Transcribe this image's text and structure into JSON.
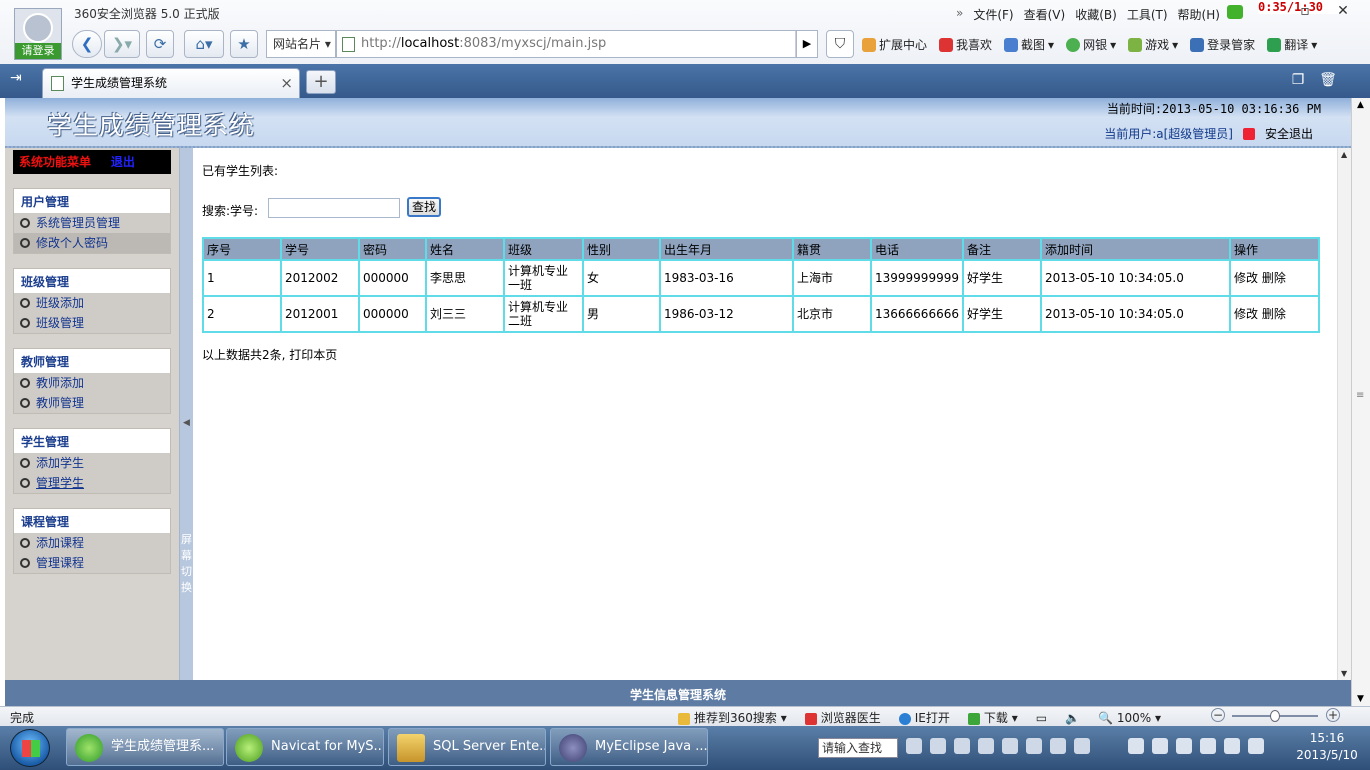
{
  "browser": {
    "title": "360安全浏览器 5.0 正式版",
    "login_label": "请登录",
    "menu": [
      "文件(F)",
      "查看(V)",
      "收藏(B)",
      "工具(T)",
      "帮助(H)"
    ],
    "clock_overlay": "0:35/1:30",
    "site_names_label": "网站名片",
    "address": {
      "scheme": "http://",
      "domain": "localhost",
      "rest": ":8083/myxscj/main.jsp"
    },
    "extensions": [
      "扩展中心",
      "我喜欢",
      "截图",
      "网银",
      "游戏",
      "登录管家",
      "翻译"
    ],
    "tab_title": "学生成绩管理系统",
    "icon_names": [
      "back-arrow-icon",
      "forward-arrow-icon",
      "refresh-icon",
      "home-icon",
      "star-icon",
      "shield-icon"
    ]
  },
  "page": {
    "system_title": "学生成绩管理系统",
    "current_time": "当前时间:2013-05-10 03:16:36 PM",
    "current_user": "当前用户:a[超级管理员]",
    "logout_label": "安全退出",
    "menu_head": "系统功能菜单",
    "menu_exit": "退出",
    "groups": [
      {
        "title": "用户管理",
        "items": [
          "系统管理员管理",
          "修改个人密码"
        ]
      },
      {
        "title": "班级管理",
        "items": [
          "班级添加",
          "班级管理"
        ]
      },
      {
        "title": "教师管理",
        "items": [
          "教师添加",
          "教师管理"
        ]
      },
      {
        "title": "学生管理",
        "items": [
          "添加学生",
          "管理学生"
        ]
      },
      {
        "title": "课程管理",
        "items": [
          "添加课程",
          "管理课程"
        ]
      }
    ],
    "splitter_text": "屏幕切换",
    "list_title": "已有学生列表:",
    "search_label": "搜索:学号:",
    "search_value": "",
    "search_button": "查找",
    "columns": [
      "序号",
      "学号",
      "密码",
      "姓名",
      "班级",
      "性别",
      "出生年月",
      "籍贯",
      "电话",
      "备注",
      "添加时间",
      "操作"
    ],
    "rows": [
      [
        "1",
        "2012002",
        "000000",
        "李思思",
        "计算机专业一班",
        "女",
        "1983-03-16",
        "上海市",
        "13999999999",
        "好学生",
        "2013-05-10 10:34:05.0"
      ],
      [
        "2",
        "2012001",
        "000000",
        "刘三三",
        "计算机专业二班",
        "男",
        "1986-03-12",
        "北京市",
        "13666666666",
        "好学生",
        "2013-05-10 10:34:05.0"
      ]
    ],
    "action_edit": "修改",
    "action_delete": "删除",
    "total_text": "以上数据共2条, 打印本页",
    "footer": "学生信息管理系统"
  },
  "statusbar": {
    "status": "完成",
    "items": [
      "推荐到360搜索",
      "浏览器医生",
      "IE打开",
      "下载"
    ],
    "zoom": "100%"
  },
  "taskbar": {
    "tasks": [
      "学生成绩管理系...",
      "Navicat for MyS...",
      "SQL Server Ente...",
      "MyEclipse Java ..."
    ],
    "search_placeholder": "请输入查找",
    "time": "15:16",
    "date": "2013/5/10"
  },
  "colors": {
    "accent": "#35598a",
    "table_border": "#5fdce8",
    "table_header": "#8fa3bf",
    "menu_title": "#1d3f8f"
  }
}
